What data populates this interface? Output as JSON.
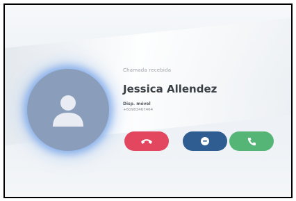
{
  "call": {
    "status": "Chamada recebida",
    "caller_name": "Jessica Allendez",
    "device_label": "Disp. móvel",
    "phone_number": "+60983467464"
  },
  "actions": [
    {
      "name": "decline",
      "icon": "phone-hangup-icon",
      "color": "#e2475f"
    },
    {
      "name": "message",
      "icon": "chat-bubble-icon",
      "color": "#2f5c91"
    },
    {
      "name": "accept",
      "icon": "phone-icon",
      "color": "#54b576"
    }
  ],
  "colors": {
    "avatar": "#8a9ebc",
    "avatar_glow": "#6296e6",
    "background": "#eef2f6"
  }
}
